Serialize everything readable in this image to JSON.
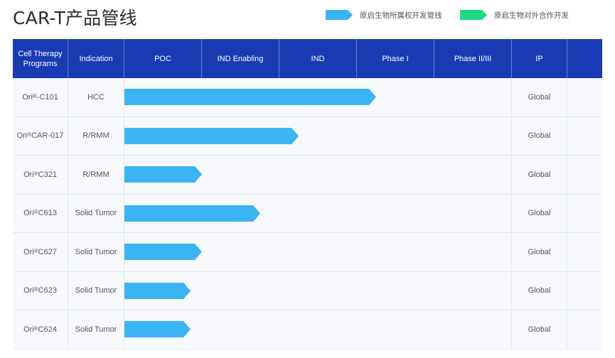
{
  "page": {
    "title": "CAR-T产品管线"
  },
  "legend": [
    {
      "label": "原启生物所属权开发管线",
      "color": "#3ab4f2"
    },
    {
      "label": "原启生物对外合作开发",
      "color": "#1ed982"
    }
  ],
  "table": {
    "columns": [
      "Cell Therapy Programs",
      "Indication",
      "POC",
      "IND Enabling",
      "IND",
      "Phase I",
      "Phase II/III",
      "IP",
      ""
    ]
  },
  "chart_data": {
    "type": "bar",
    "orientation": "horizontal",
    "stages": [
      "POC",
      "IND Enabling",
      "IND",
      "Phase I",
      "Phase II/III"
    ],
    "categories": [
      "Ori®-C101",
      "Ori®CAR-017",
      "Ori®C321",
      "Ori®C613",
      "Ori®C627",
      "Ori®C623",
      "Ori®C624"
    ],
    "values": [
      3.25,
      2.25,
      1.0,
      1.75,
      1.0,
      0.85,
      0.85
    ],
    "xlim": [
      0,
      5
    ],
    "rows": [
      {
        "prefix": "Ori",
        "sup": "®",
        "suffix": "-C101",
        "indication": "HCC",
        "ip": "Global",
        "progress": 3.25
      },
      {
        "prefix": "Ori",
        "sup": "®",
        "suffix": "CAR-017",
        "indication": "R/RMM",
        "ip": "Global",
        "progress": 2.25
      },
      {
        "prefix": "Ori",
        "sup": "®",
        "suffix": "C321",
        "indication": "R/RMM",
        "ip": "Global",
        "progress": 1.0
      },
      {
        "prefix": "Ori",
        "sup": "®",
        "suffix": "C613",
        "indication": "Solid Tumor",
        "ip": "Global",
        "progress": 1.75
      },
      {
        "prefix": "Ori",
        "sup": "®",
        "suffix": "C627",
        "indication": "Solid Tumor",
        "ip": "Global",
        "progress": 1.0
      },
      {
        "prefix": "Ori",
        "sup": "®",
        "suffix": "C623",
        "indication": "Solid Tumor",
        "ip": "Global",
        "progress": 0.85
      },
      {
        "prefix": "Ori",
        "sup": "®",
        "suffix": "C624",
        "indication": "Solid Tumor",
        "ip": "Global",
        "progress": 0.85
      }
    ]
  },
  "colors": {
    "header_bg": "#1a3bb4",
    "bar": "#3ab4f2",
    "row_bg": "#f7f9fd"
  }
}
